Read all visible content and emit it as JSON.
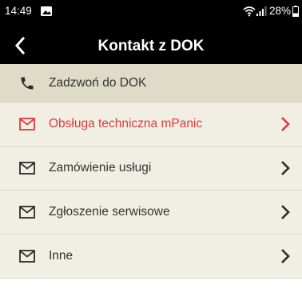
{
  "status_bar": {
    "time": "14:49",
    "battery": "28%",
    "icons": [
      "gallery-icon",
      "wifi-icon",
      "signal-icon",
      "battery-icon"
    ]
  },
  "toolbar": {
    "title": "Kontakt z DOK",
    "back_icon": "chevron-left-icon"
  },
  "menu": {
    "items": [
      {
        "label": "Zadzwoń do DOK",
        "icon": "phone-icon",
        "active": false,
        "chevron": false
      },
      {
        "label": "Obsługa techniczna mPanic",
        "icon": "mail-icon",
        "active": true,
        "chevron": true
      },
      {
        "label": "Zamówienie usługi",
        "icon": "mail-icon",
        "active": false,
        "chevron": true
      },
      {
        "label": "Zgłoszenie serwisowe",
        "icon": "mail-icon",
        "active": false,
        "chevron": true
      },
      {
        "label": "Inne",
        "icon": "mail-icon",
        "active": false,
        "chevron": true
      }
    ]
  },
  "colors": {
    "accent": "#e0393e",
    "text": "#333333",
    "bar_bg": "#000000",
    "list_bg": "#f1efe4",
    "header_bg": "#dedbc6"
  }
}
